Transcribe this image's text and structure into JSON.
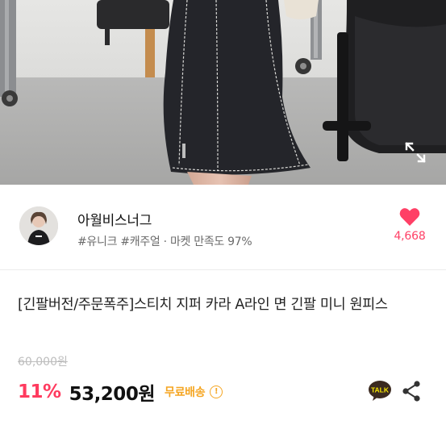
{
  "seller": {
    "name": "아월비스너그",
    "tags": "#유니크 #캐주얼 · 마켓 만족도 97%",
    "like_count": "4,668"
  },
  "product": {
    "title": "[긴팔버전/주문폭주]스티치 지퍼 카라 A라인 면 긴팔 미니 원피스",
    "original_price": "60,000원",
    "discount": "11%",
    "price": "53,200원",
    "shipping": "무료배송",
    "info_icon_char": "!",
    "talk_label": "TALK"
  },
  "colors": {
    "accent_pink": "#ff3b5f",
    "shipping_orange": "#f5a623",
    "kakao_yellow": "#f7e600"
  },
  "icons": [
    "expand-icon",
    "heart-icon",
    "info-icon",
    "kakao-talk-icon",
    "share-icon"
  ]
}
